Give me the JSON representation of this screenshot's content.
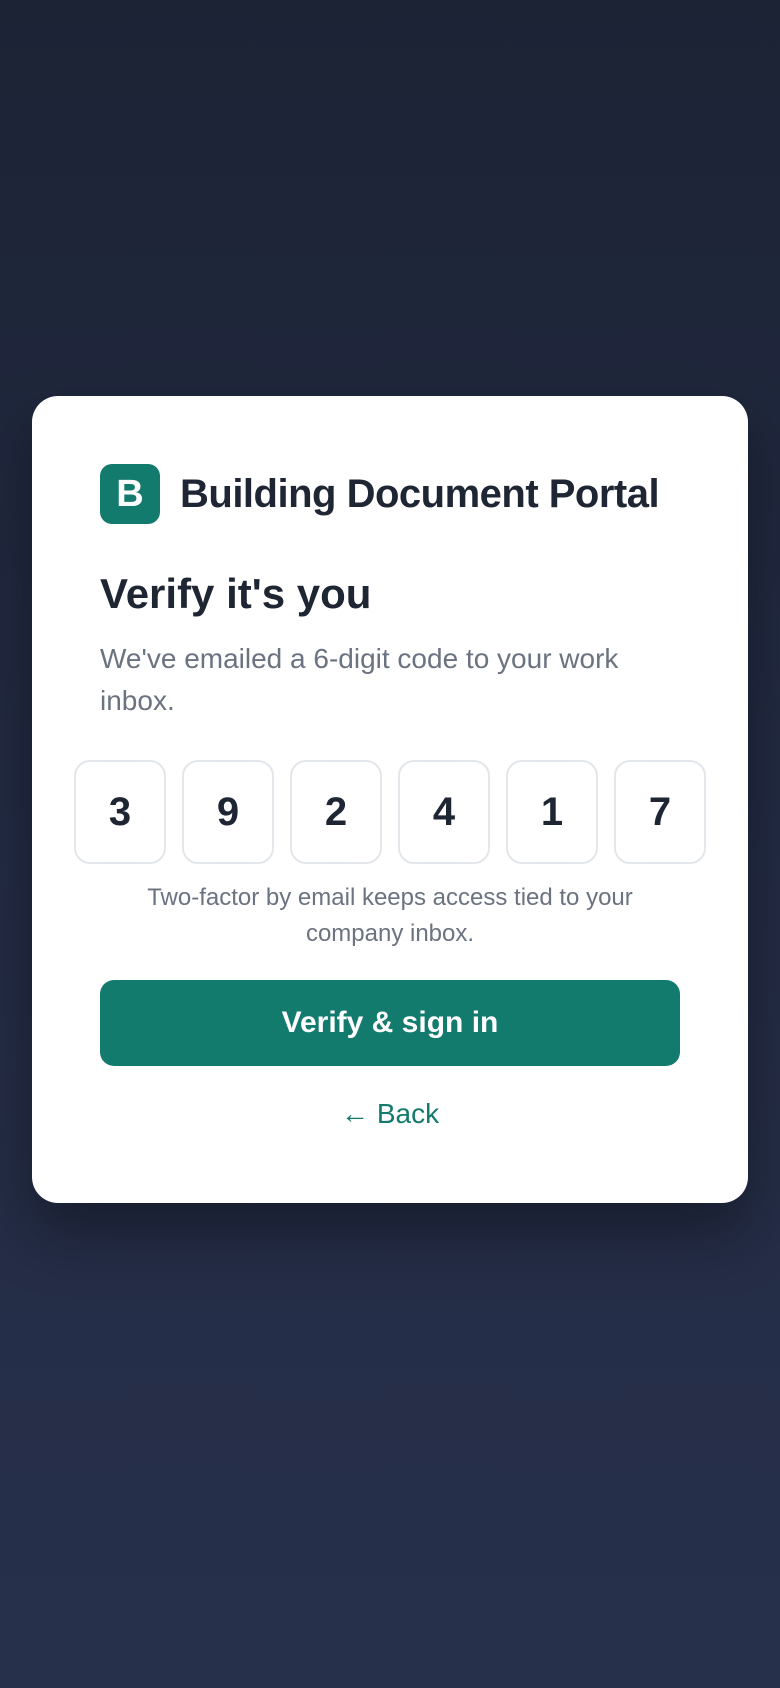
{
  "brand": {
    "logo_letter": "B",
    "name": "Building Document Portal",
    "color": "#137a6e"
  },
  "verify": {
    "title": "Verify it's you",
    "subtitle": "We've emailed a 6-digit code to your work inbox.",
    "code_digits": [
      "3",
      "9",
      "2",
      "4",
      "1",
      "7"
    ],
    "hint": "Two-factor by email keeps access tied to your company inbox.",
    "submit_label": "Verify & sign in",
    "back_arrow": "←",
    "back_label": "Back"
  },
  "icons": {
    "back": "left-arrow-icon"
  }
}
